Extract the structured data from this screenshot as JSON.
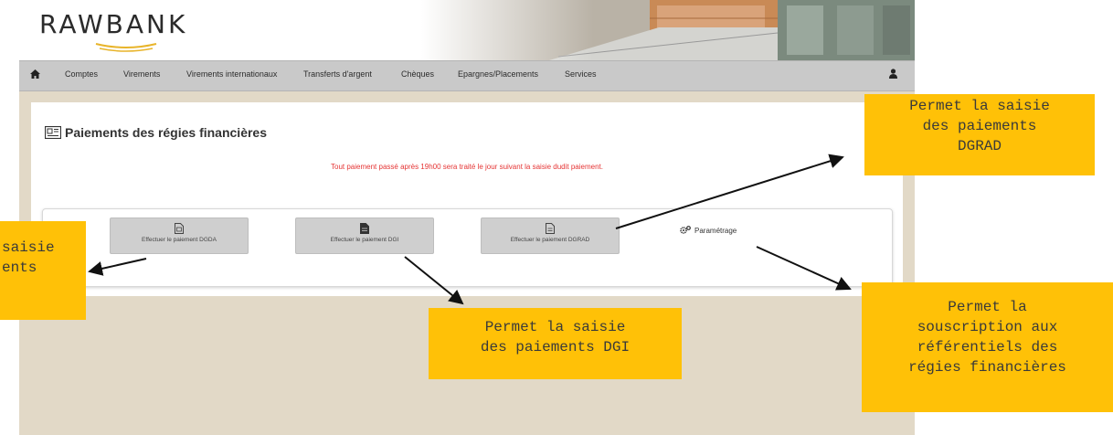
{
  "brand": {
    "name": "RAWBANK"
  },
  "nav": {
    "items": [
      {
        "label": "Comptes"
      },
      {
        "label": "Virements"
      },
      {
        "label": "Virements internationaux"
      },
      {
        "label": "Transferts d'argent"
      },
      {
        "label": "Chèques"
      },
      {
        "label": "Epargnes/Placements"
      },
      {
        "label": "Services"
      }
    ]
  },
  "page": {
    "title": "Paiements des régies financières",
    "notice": "Tout paiement passé après 19h00 sera traité le jour suivant la saisie dudit paiement."
  },
  "actions": {
    "dgda": "Effectuer le paiement DGDA",
    "dgi": "Effectuer le paiement DGI",
    "dgrad": "Effectuer le paiement DGRAD",
    "param": "Paramétrage"
  },
  "callouts": {
    "dgrad": "Permet la saisie\ndes paiements\nDGRAD",
    "dgda": "saisie\nents",
    "dgi": "Permet la saisie\ndes paiements DGI",
    "param": "Permet la\nsouscription aux\nréférentiels des\nrégies financières"
  },
  "colors": {
    "callout": "#ffc107",
    "notice": "#e53535",
    "nav_bg": "#c9c9c9",
    "page_bg": "#e2d9c7"
  }
}
